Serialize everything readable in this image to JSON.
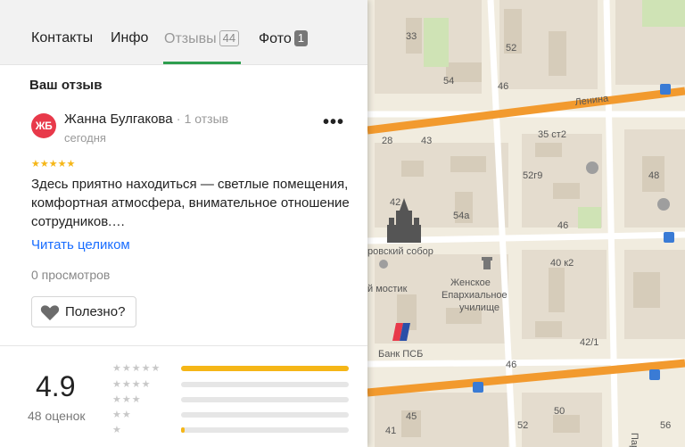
{
  "tabs": [
    {
      "label": "Контакты"
    },
    {
      "label": "Инфо"
    },
    {
      "label": "Отзывы",
      "count": "44",
      "active": true
    },
    {
      "label": "Фото",
      "count": "1"
    }
  ],
  "review_section": {
    "title": "Ваш отзыв",
    "author": {
      "initials": "ЖБ",
      "name": "Жанна Булгакова",
      "reviews_count": "1 отзыв",
      "avatar_color": "#e8394a"
    },
    "date": "сегодня",
    "stars": "★★★★★",
    "text": "Здесь приятно находиться — светлые помещения, комфортная атмосфера, внимательное отношение сотрудников.…",
    "read_more": "Читать целиком",
    "views": "0 просмотров",
    "helpful_label": "Полезно?",
    "more_icon": "•••"
  },
  "rating_summary": {
    "score": "4.9",
    "count": "48 оценок",
    "rows": [
      {
        "stars": "★★★★★",
        "fraction": 1.0
      },
      {
        "stars": "★★★★",
        "fraction": 0.0
      },
      {
        "stars": "★★★",
        "fraction": 0.0
      },
      {
        "stars": "★★",
        "fraction": 0.0
      },
      {
        "stars": "★",
        "fraction": 0.02
      }
    ]
  },
  "map": {
    "street_lenina": "Ленина",
    "street_pari": "Пари",
    "labels": [
      "33",
      "52",
      "54",
      "46",
      "28",
      "43",
      "35 ст2",
      "52г9",
      "54а",
      "46",
      "48",
      "42",
      "40 к2",
      "42/1",
      "46",
      "50",
      "41",
      "45",
      "52",
      "56"
    ],
    "places": {
      "cathedral": "ровский собор",
      "bridge": "й мостик",
      "school_line1": "Женское",
      "school_line2": "Епархиальное",
      "school_line3": "училище",
      "bank": "Банк ПСБ"
    },
    "colors": {
      "road": "#f29a2e",
      "park": "#cfe3b5",
      "block": "#e4dcce",
      "ground": "#f1ecdf"
    }
  }
}
